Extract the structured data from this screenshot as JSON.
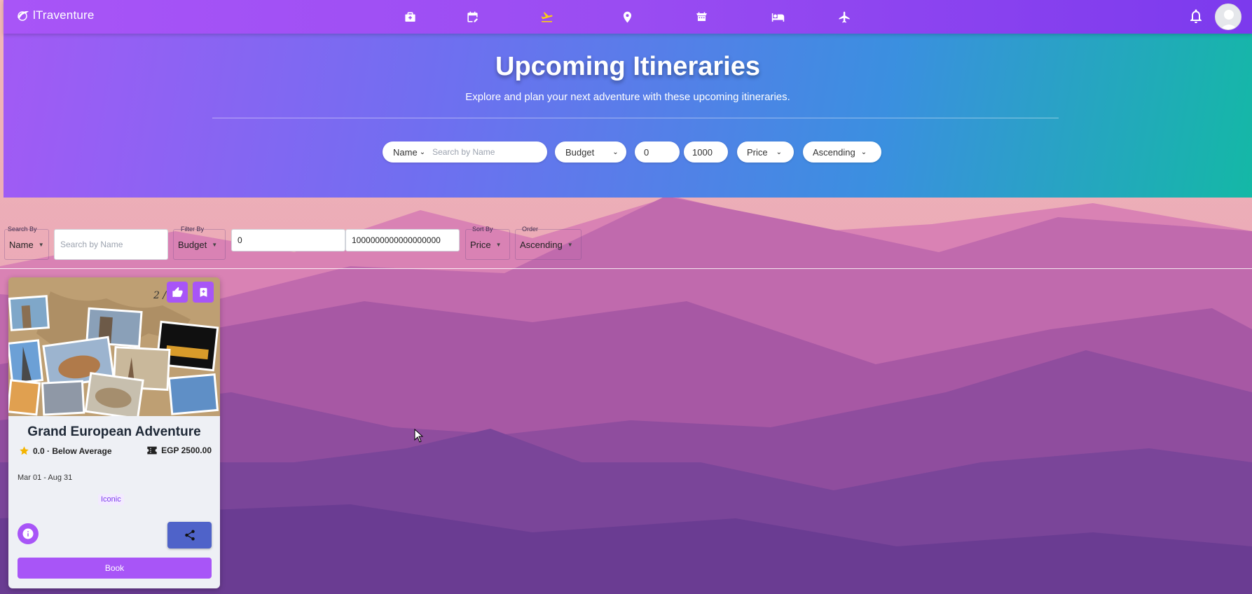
{
  "app": {
    "name": "lTraventure"
  },
  "nav": {
    "icons": [
      "suitcase-icon",
      "calendar-edit-icon",
      "flight-takeoff-icon",
      "location-pin-icon",
      "event-icon",
      "bed-icon",
      "airplane-icon"
    ],
    "active": "flight-takeoff-icon"
  },
  "hero": {
    "title": "Upcoming Itineraries",
    "subtitle": "Explore and plan your next adventure with these upcoming itineraries."
  },
  "top_filters": {
    "search_by": "Name",
    "search_placeholder": "Search by Name",
    "filter_by": "Budget",
    "min": "0",
    "max": "1000",
    "sort_by": "Price",
    "order": "Ascending"
  },
  "filters": {
    "search_by_label": "Search By",
    "search_by_value": "Name",
    "search_placeholder": "Search by Name",
    "filter_by_label": "Filter By",
    "filter_by_value": "Budget",
    "min_value": "0",
    "max_value": "1000000000000000000",
    "sort_by_label": "Sort By",
    "sort_by_value": "Price",
    "order_label": "Order",
    "order_value": "Ascending"
  },
  "card": {
    "title": "Grand European Adventure",
    "rating": "0.0 · Below Average",
    "price": "EGP 2500.00",
    "dates": "Mar 01 - Aug 31",
    "tag": "Iconic",
    "book_label": "Book",
    "image_text": "2 /"
  },
  "colors": {
    "accent": "#a855f7",
    "active_nav": "#facc15",
    "share": "#4f63c9"
  }
}
